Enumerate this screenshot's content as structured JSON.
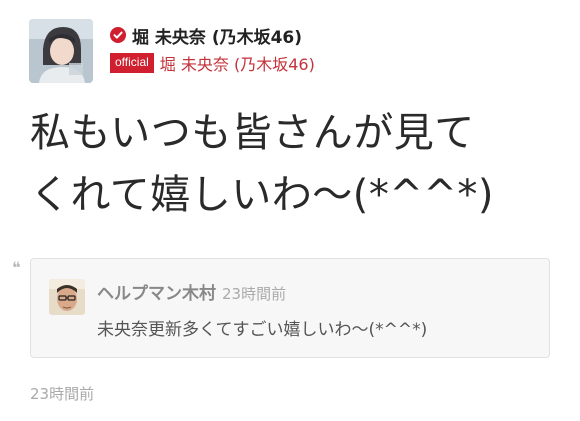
{
  "post": {
    "author_name": "堀 未央奈 (乃木坂46)",
    "verified_icon": "verified-check-icon",
    "official_badge": "official",
    "official_name": "堀 未央奈 (乃木坂46)",
    "text": "私もいつも皆さんが見て\nくれて嬉しいわ〜(*^^*)",
    "timestamp": "23時間前"
  },
  "quote_icon": "quote-mark-icon",
  "reply": {
    "author_name": "ヘルプマン木村",
    "timestamp": "23時間前",
    "text": "未央奈更新多くてすごい嬉しいわ〜(*^^*)"
  },
  "colors": {
    "brand_red": "#d01f2e",
    "official_name_red": "#c4323a",
    "reply_bg": "#f7f7f7",
    "muted_text": "#aaaaaa"
  }
}
